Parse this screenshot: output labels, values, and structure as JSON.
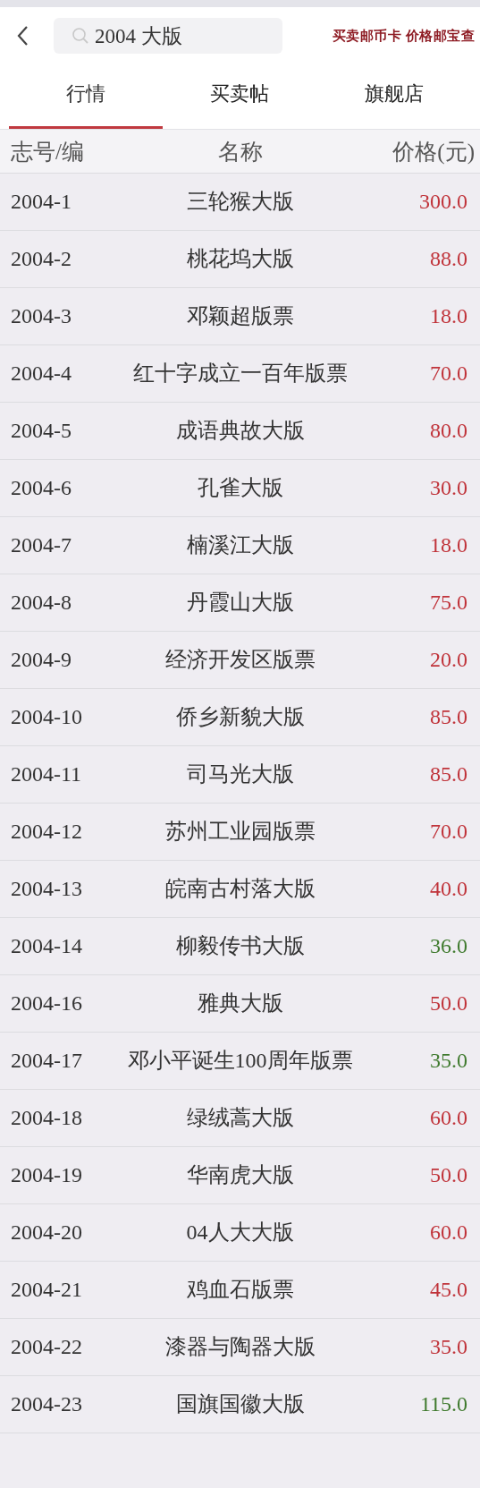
{
  "search": {
    "value": "2004 大版"
  },
  "brand_slogan": "买卖邮币卡 价格邮宝查",
  "tabs": [
    {
      "label": "行情",
      "selected": true
    },
    {
      "label": "买卖帖",
      "selected": false
    },
    {
      "label": "旗舰店",
      "selected": false
    }
  ],
  "table": {
    "columns": [
      "志号/编",
      "名称",
      "价格(元)"
    ],
    "rows": [
      {
        "id": "2004-1",
        "name": "三轮猴大版",
        "price": "300.0",
        "color": "#c0333a"
      },
      {
        "id": "2004-2",
        "name": "桃花坞大版",
        "price": "88.0",
        "color": "#c0333a"
      },
      {
        "id": "2004-3",
        "name": "邓颖超版票",
        "price": "18.0",
        "color": "#c0333a"
      },
      {
        "id": "2004-4",
        "name": "红十字成立一百年版票",
        "price": "70.0",
        "color": "#c0333a"
      },
      {
        "id": "2004-5",
        "name": "成语典故大版",
        "price": "80.0",
        "color": "#c0333a"
      },
      {
        "id": "2004-6",
        "name": "孔雀大版",
        "price": "30.0",
        "color": "#c0333a"
      },
      {
        "id": "2004-7",
        "name": "楠溪江大版",
        "price": "18.0",
        "color": "#c0333a"
      },
      {
        "id": "2004-8",
        "name": "丹霞山大版",
        "price": "75.0",
        "color": "#c0333a"
      },
      {
        "id": "2004-9",
        "name": "经济开发区版票",
        "price": "20.0",
        "color": "#c0333a"
      },
      {
        "id": "2004-10",
        "name": "侨乡新貌大版",
        "price": "85.0",
        "color": "#c0333a"
      },
      {
        "id": "2004-11",
        "name": "司马光大版",
        "price": "85.0",
        "color": "#c0333a"
      },
      {
        "id": "2004-12",
        "name": "苏州工业园版票",
        "price": "70.0",
        "color": "#c0333a"
      },
      {
        "id": "2004-13",
        "name": "皖南古村落大版",
        "price": "40.0",
        "color": "#c0333a"
      },
      {
        "id": "2004-14",
        "name": "柳毅传书大版",
        "price": "36.0",
        "color": "#3f7a2e"
      },
      {
        "id": "2004-16",
        "name": "雅典大版",
        "price": "50.0",
        "color": "#c0333a"
      },
      {
        "id": "2004-17",
        "name": "邓小平诞生100周年版票",
        "price": "35.0",
        "color": "#3f7a2e"
      },
      {
        "id": "2004-18",
        "name": "绿绒蒿大版",
        "price": "60.0",
        "color": "#c0333a"
      },
      {
        "id": "2004-19",
        "name": "华南虎大版",
        "price": "50.0",
        "color": "#c0333a"
      },
      {
        "id": "2004-20",
        "name": "04人大大版",
        "price": "60.0",
        "color": "#c0333a"
      },
      {
        "id": "2004-21",
        "name": "鸡血石版票",
        "price": "45.0",
        "color": "#c0333a"
      },
      {
        "id": "2004-22",
        "name": "漆器与陶器大版",
        "price": "35.0",
        "color": "#c0333a"
      },
      {
        "id": "2004-23",
        "name": "国旗国徽大版",
        "price": "115.0",
        "color": "#3f7a2e"
      }
    ]
  }
}
